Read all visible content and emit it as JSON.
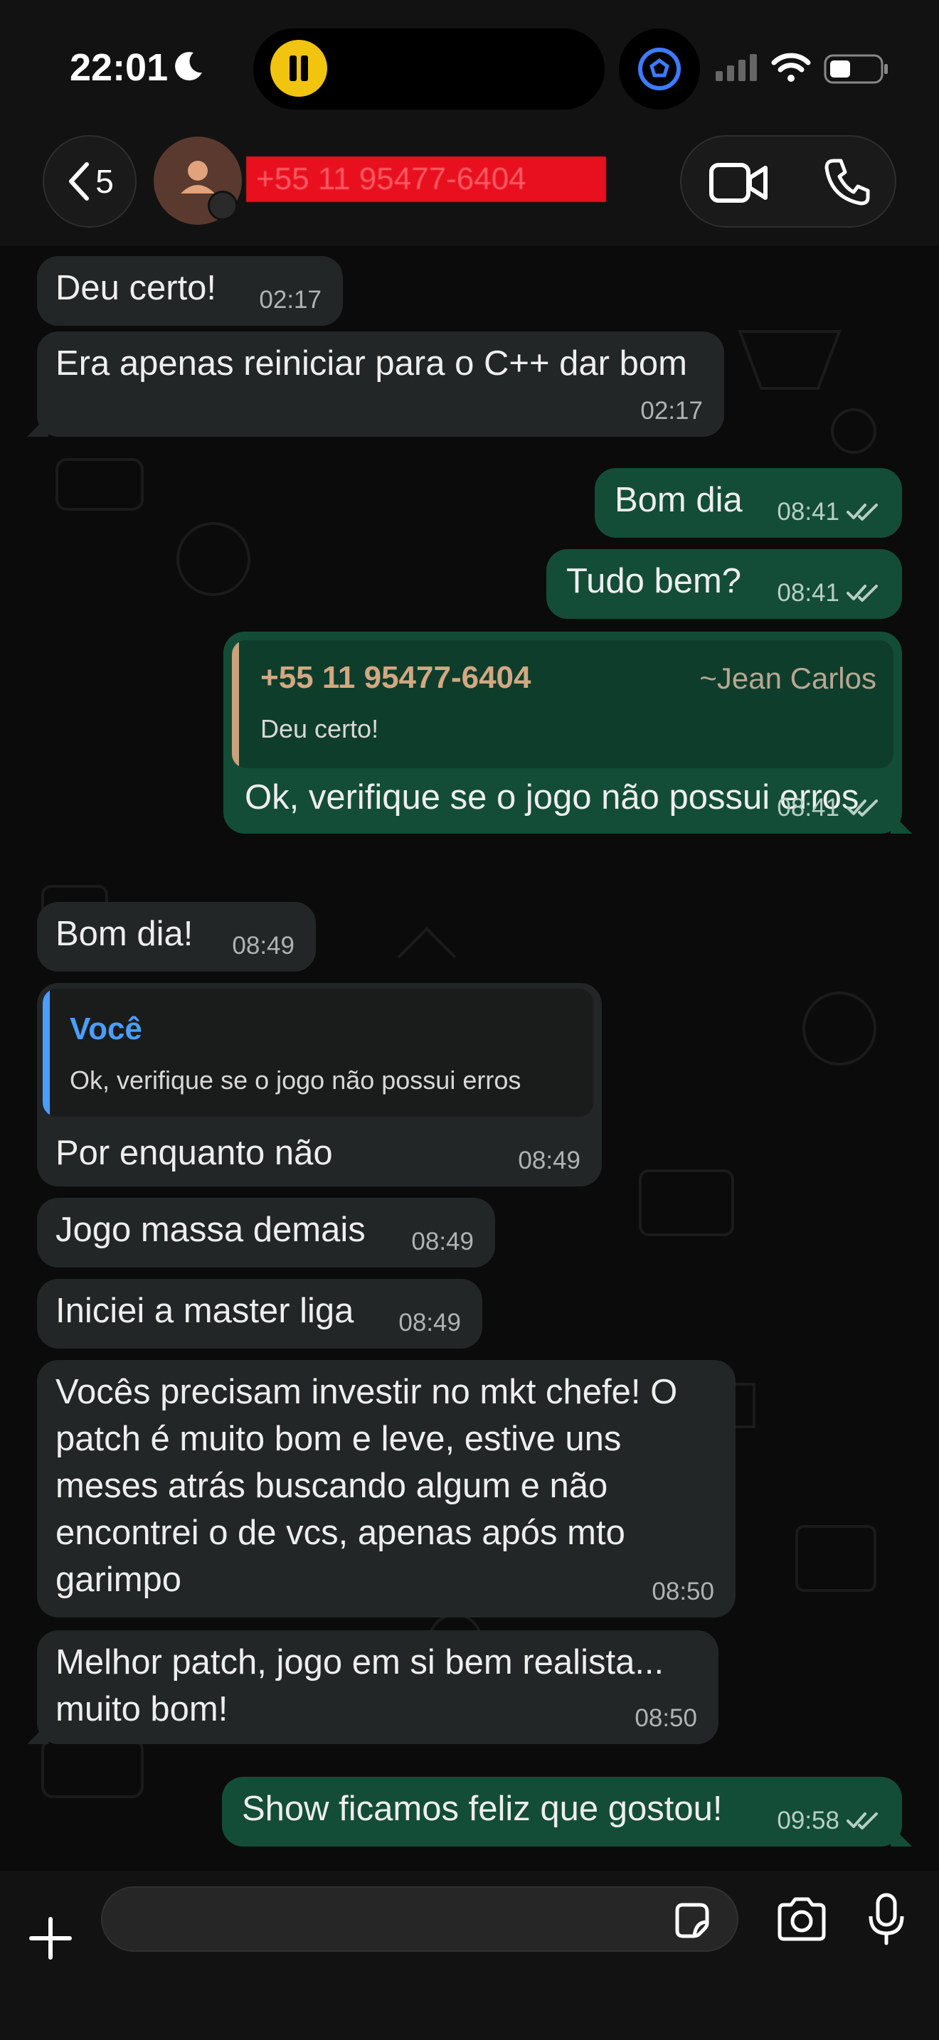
{
  "status": {
    "time": "22:01"
  },
  "header": {
    "back_count": "5",
    "contact_name": "+55 11 95477-6404"
  },
  "messages": [
    {
      "text": "Deu certo!",
      "time": "02:17"
    },
    {
      "text": "Era apenas reiniciar para o C++ dar bom",
      "time": "02:17"
    },
    {
      "text": "Bom dia",
      "time": "08:41"
    },
    {
      "text": "Tudo bem?",
      "time": "08:41"
    },
    {
      "quote_author": "+55 11 95477-6404",
      "quote_side": "~Jean Carlos",
      "quote_text": "Deu certo!",
      "text": "Ok, verifique se o jogo não possui erros",
      "time": "08:41"
    },
    {
      "text": "Bom dia!",
      "time": "08:49"
    },
    {
      "quote_author": "Você",
      "quote_text": "Ok, verifique se o jogo não possui erros",
      "text": "Por enquanto não",
      "time": "08:49"
    },
    {
      "text": "Jogo massa demais",
      "time": "08:49"
    },
    {
      "text": "Iniciei a master liga",
      "time": "08:49"
    },
    {
      "text": "Vocês precisam investir no mkt chefe! O\npatch é muito bom e leve, estive uns\nmeses atrás buscando algum e não\nencontrei o de vcs, apenas após mto\ngarimpo",
      "time": "08:50"
    },
    {
      "text": "Melhor patch, jogo em si bem realista...\nmuito bom!",
      "time": "08:50"
    },
    {
      "text": "Show ficamos feliz que gostou!",
      "time": "09:58"
    }
  ],
  "input": {
    "placeholder": ""
  },
  "colors": {
    "incoming_bubble": "#232626",
    "outgoing_bubble": "#144d37",
    "quote_accent_incoming": "#c9a27c",
    "quote_accent_self": "#4a9eff"
  }
}
